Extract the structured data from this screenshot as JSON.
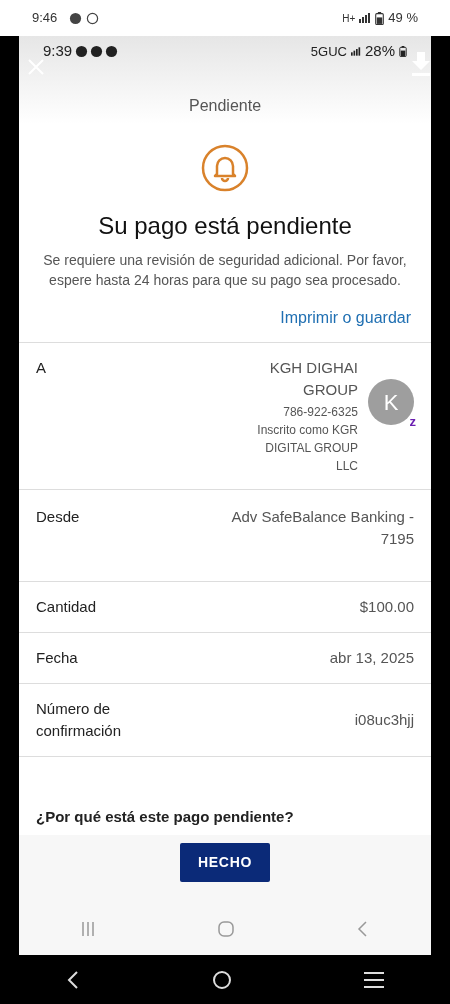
{
  "outer_status_bar": {
    "time": "9:46",
    "network": "H+",
    "battery": "49 %"
  },
  "inner_status_bar": {
    "time": "9:39",
    "network": "5GUC",
    "battery": "28%"
  },
  "header": {
    "title": "Pendiente"
  },
  "notice": {
    "title": "Su pago está pendiente",
    "message": "Se requiere una revisión de seguridad adicional. Por favor, espere hasta 24 horas para que su pago sea procesado.",
    "link": "Imprimir o guardar"
  },
  "recipient": {
    "label": "A",
    "name": "KGH DIGHAI GROUP",
    "phone": "786-922-6325",
    "registered": "Inscrito como KGR DIGITAL GROUP LLC",
    "avatar": "K",
    "badge": "z"
  },
  "details": [
    {
      "label": "Desde",
      "value": "Adv SafeBalance Banking - 7195"
    },
    {
      "label": "Cantidad",
      "value": "$100.00"
    },
    {
      "label": "Fecha",
      "value": "abr 13, 2025"
    },
    {
      "label": "Número de confirmación",
      "value": "i08uc3hjj"
    }
  ],
  "section_heading": "¿Por qué está este pago pendiente?",
  "done_button": "HECHO"
}
